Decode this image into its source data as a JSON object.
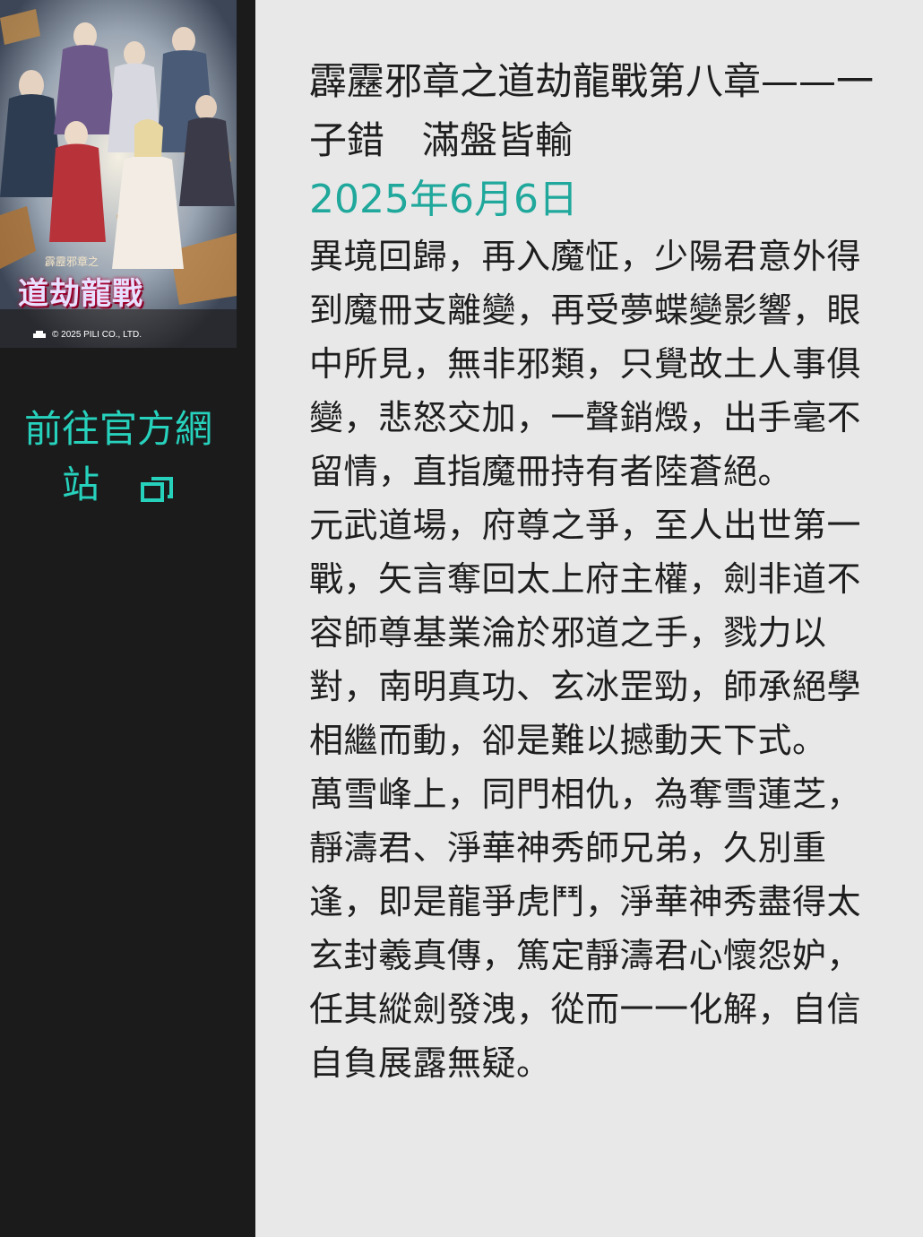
{
  "sidebar": {
    "poster": {
      "subtitle": "霹靂邪章之",
      "title_art": "道劫龍戰",
      "copyright": "© 2025 PILI CO., LTD."
    },
    "official_link": {
      "line1": "前往官方網",
      "line2": "站",
      "icon": "external-link-icon",
      "color": "#27d2bd"
    }
  },
  "main": {
    "title": "霹靂邪章之道劫龍戰第八章——一子錯　滿盤皆輸",
    "date": "2025年6月6日",
    "date_color": "#1fa89b",
    "paragraphs": [
      "異境回歸，再入魔怔，少陽君意外得到魔冊支離變，再受夢蝶變影響，眼中所見，無非邪類，只覺故土人事俱變，悲怒交加，一聲銷燬，出手毫不留情，直指魔冊持有者陸蒼絕。",
      "元武道場，府尊之爭，至人出世第一戰，矢言奪回太上府主權，劍非道不容師尊基業淪於邪道之手，戮力以對，南明真功、玄冰罡勁，師承絕學相繼而動，卻是難以撼動天下式。",
      "萬雪峰上，同門相仇，為奪雪蓮芝，靜濤君、淨華神秀師兄弟，久別重逢，即是龍爭虎鬥，淨華神秀盡得太玄封羲真傳，篤定靜濤君心懷怨妒，任其縱劍發洩，從而一一化解，自信自負展露無疑。"
    ]
  }
}
